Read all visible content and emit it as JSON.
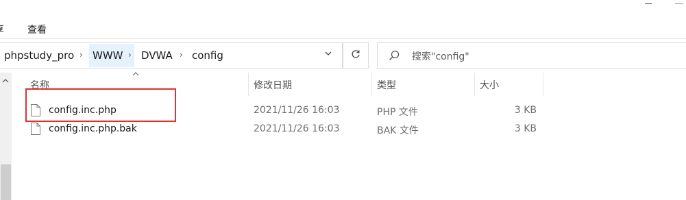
{
  "ribbon": {
    "tab_partial": "享",
    "tab_view": "查看"
  },
  "address": {
    "crumbs": [
      "phpstudy_pro",
      "WWW",
      "DVWA",
      "config"
    ],
    "separator": "›",
    "dropdown_glyph": "⌄"
  },
  "search": {
    "placeholder": "搜索\"config\""
  },
  "columns": {
    "name": "名称",
    "modified": "修改日期",
    "type": "类型",
    "size": "大小",
    "sort_glyph": "^"
  },
  "files": [
    {
      "name": "config.inc.php",
      "modified": "2021/11/26 16:03",
      "type": "PHP 文件",
      "size": "3 KB",
      "icon": "file-icon"
    },
    {
      "name": "config.inc.php.bak",
      "modified": "2021/11/26 16:03",
      "type": "BAK 文件",
      "size": "3 KB",
      "icon": "file-icon"
    }
  ],
  "colors": {
    "annotation": "#e03030",
    "crumb_hover": "#e5f1fb"
  }
}
